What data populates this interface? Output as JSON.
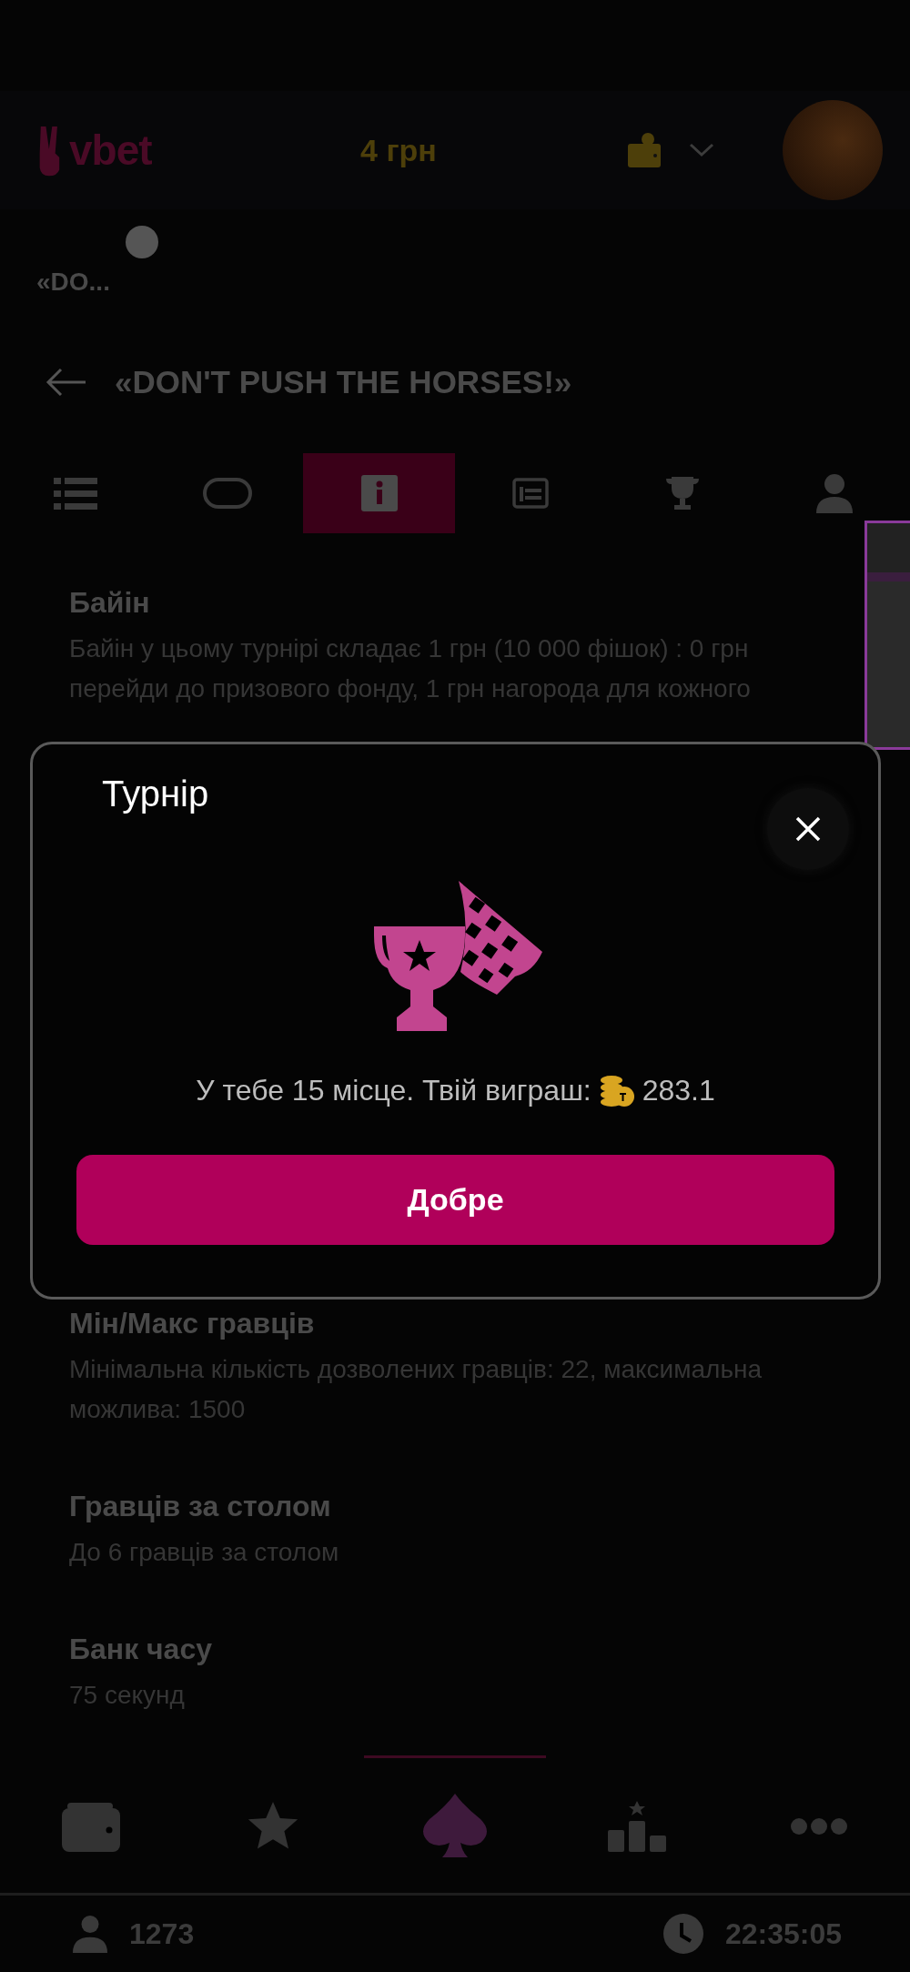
{
  "header": {
    "logo": "vbet",
    "balance": "4 грн"
  },
  "breadcrumb": "«DO...",
  "page_title": "«DON'T PUSH THE HORSES!»",
  "tabs": [
    {
      "kind": "list",
      "selected": false
    },
    {
      "kind": "table",
      "selected": false
    },
    {
      "kind": "info",
      "selected": true
    },
    {
      "kind": "news",
      "selected": false
    },
    {
      "kind": "trophy",
      "selected": false
    },
    {
      "kind": "user",
      "selected": false
    }
  ],
  "sections": [
    {
      "heading": "Байін",
      "text": "Байін у цьому турнірі складає 1 грн (10 000 фішок) : 0 грн перейди до призового фонду, 1 грн нагорода для кожного"
    },
    {
      "heading": "Мін/Макс гравців",
      "text": "Мінімальна кількість дозволених гравців: 22, максимальна можлива: 1500"
    },
    {
      "heading": "Гравців за столом",
      "text": "До 6 гравців за столом"
    },
    {
      "heading": "Банк часу",
      "text": "75 секунд"
    }
  ],
  "modal": {
    "title": "Турнір",
    "message": "У тебе 15 місце. Твій виграш:",
    "amount": "283.1",
    "button": "Добре"
  },
  "bottom_nav": [
    {
      "kind": "wallet",
      "selected": false
    },
    {
      "kind": "star",
      "selected": false
    },
    {
      "kind": "spade",
      "selected": true
    },
    {
      "kind": "podium",
      "selected": false
    },
    {
      "kind": "more",
      "selected": false
    }
  ],
  "status_bar": {
    "players": "1273",
    "time": "22:35:05"
  }
}
